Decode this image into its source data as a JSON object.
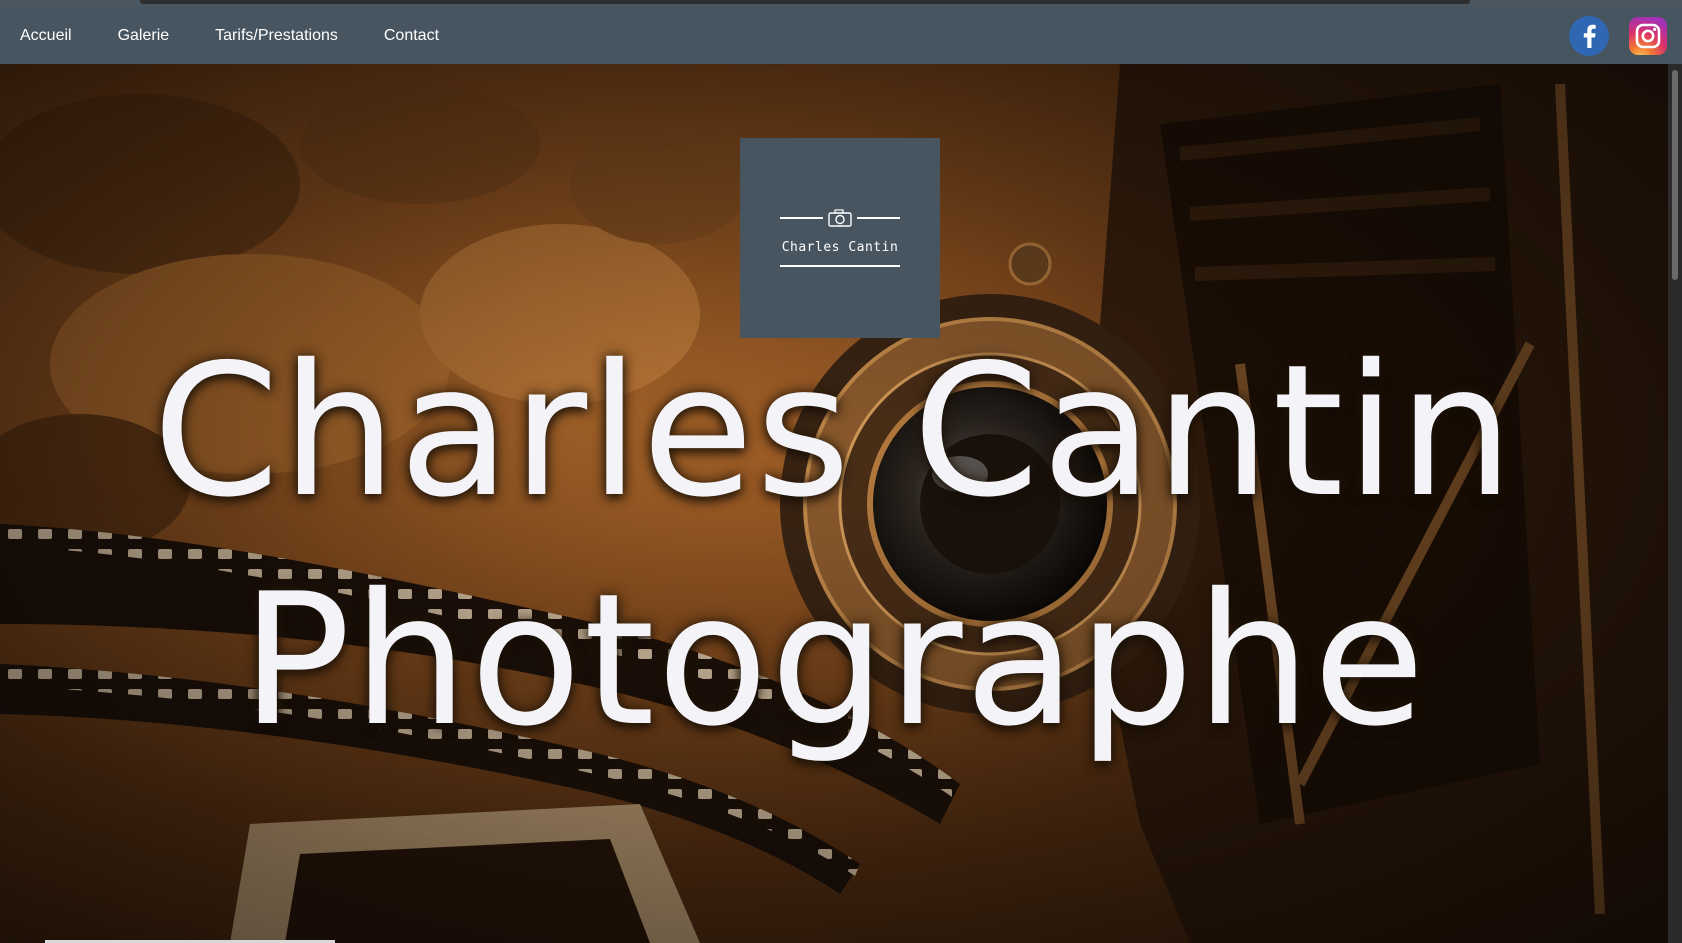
{
  "nav": {
    "items": [
      {
        "label": "Accueil"
      },
      {
        "label": "Galerie"
      },
      {
        "label": "Tarifs/Prestations"
      },
      {
        "label": "Contact"
      }
    ]
  },
  "social": {
    "facebook_letter": "f",
    "facebook_color": "#2f67b2",
    "instagram_icon": "instagram-icon",
    "facebook_icon": "facebook-icon"
  },
  "logo": {
    "name": "Charles Cantin",
    "icon": "camera-icon",
    "background": "#475560"
  },
  "hero": {
    "line1": "Charles Cantin",
    "line2": "Photographe",
    "background_image": "sepia vintage folding camera and film strip",
    "text_color": "#f4f4f8"
  },
  "colors": {
    "navbar": "#475560",
    "accent": "#b06a2c"
  }
}
